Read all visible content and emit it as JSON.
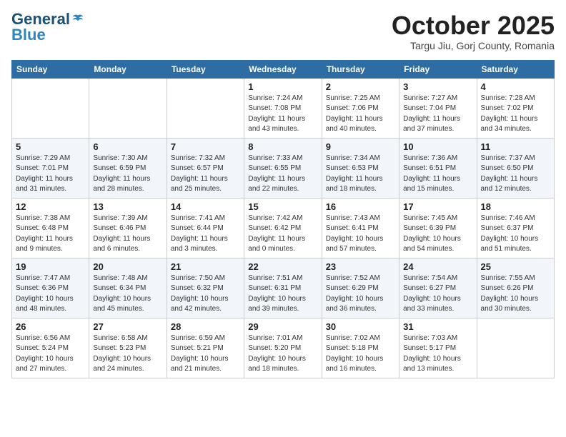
{
  "header": {
    "logo_general": "General",
    "logo_blue": "Blue",
    "month_title": "October 2025",
    "subtitle": "Targu Jiu, Gorj County, Romania"
  },
  "weekdays": [
    "Sunday",
    "Monday",
    "Tuesday",
    "Wednesday",
    "Thursday",
    "Friday",
    "Saturday"
  ],
  "weeks": [
    [
      {
        "day": "",
        "info": ""
      },
      {
        "day": "",
        "info": ""
      },
      {
        "day": "",
        "info": ""
      },
      {
        "day": "1",
        "info": "Sunrise: 7:24 AM\nSunset: 7:08 PM\nDaylight: 11 hours and 43 minutes."
      },
      {
        "day": "2",
        "info": "Sunrise: 7:25 AM\nSunset: 7:06 PM\nDaylight: 11 hours and 40 minutes."
      },
      {
        "day": "3",
        "info": "Sunrise: 7:27 AM\nSunset: 7:04 PM\nDaylight: 11 hours and 37 minutes."
      },
      {
        "day": "4",
        "info": "Sunrise: 7:28 AM\nSunset: 7:02 PM\nDaylight: 11 hours and 34 minutes."
      }
    ],
    [
      {
        "day": "5",
        "info": "Sunrise: 7:29 AM\nSunset: 7:01 PM\nDaylight: 11 hours and 31 minutes."
      },
      {
        "day": "6",
        "info": "Sunrise: 7:30 AM\nSunset: 6:59 PM\nDaylight: 11 hours and 28 minutes."
      },
      {
        "day": "7",
        "info": "Sunrise: 7:32 AM\nSunset: 6:57 PM\nDaylight: 11 hours and 25 minutes."
      },
      {
        "day": "8",
        "info": "Sunrise: 7:33 AM\nSunset: 6:55 PM\nDaylight: 11 hours and 22 minutes."
      },
      {
        "day": "9",
        "info": "Sunrise: 7:34 AM\nSunset: 6:53 PM\nDaylight: 11 hours and 18 minutes."
      },
      {
        "day": "10",
        "info": "Sunrise: 7:36 AM\nSunset: 6:51 PM\nDaylight: 11 hours and 15 minutes."
      },
      {
        "day": "11",
        "info": "Sunrise: 7:37 AM\nSunset: 6:50 PM\nDaylight: 11 hours and 12 minutes."
      }
    ],
    [
      {
        "day": "12",
        "info": "Sunrise: 7:38 AM\nSunset: 6:48 PM\nDaylight: 11 hours and 9 minutes."
      },
      {
        "day": "13",
        "info": "Sunrise: 7:39 AM\nSunset: 6:46 PM\nDaylight: 11 hours and 6 minutes."
      },
      {
        "day": "14",
        "info": "Sunrise: 7:41 AM\nSunset: 6:44 PM\nDaylight: 11 hours and 3 minutes."
      },
      {
        "day": "15",
        "info": "Sunrise: 7:42 AM\nSunset: 6:42 PM\nDaylight: 11 hours and 0 minutes."
      },
      {
        "day": "16",
        "info": "Sunrise: 7:43 AM\nSunset: 6:41 PM\nDaylight: 10 hours and 57 minutes."
      },
      {
        "day": "17",
        "info": "Sunrise: 7:45 AM\nSunset: 6:39 PM\nDaylight: 10 hours and 54 minutes."
      },
      {
        "day": "18",
        "info": "Sunrise: 7:46 AM\nSunset: 6:37 PM\nDaylight: 10 hours and 51 minutes."
      }
    ],
    [
      {
        "day": "19",
        "info": "Sunrise: 7:47 AM\nSunset: 6:36 PM\nDaylight: 10 hours and 48 minutes."
      },
      {
        "day": "20",
        "info": "Sunrise: 7:48 AM\nSunset: 6:34 PM\nDaylight: 10 hours and 45 minutes."
      },
      {
        "day": "21",
        "info": "Sunrise: 7:50 AM\nSunset: 6:32 PM\nDaylight: 10 hours and 42 minutes."
      },
      {
        "day": "22",
        "info": "Sunrise: 7:51 AM\nSunset: 6:31 PM\nDaylight: 10 hours and 39 minutes."
      },
      {
        "day": "23",
        "info": "Sunrise: 7:52 AM\nSunset: 6:29 PM\nDaylight: 10 hours and 36 minutes."
      },
      {
        "day": "24",
        "info": "Sunrise: 7:54 AM\nSunset: 6:27 PM\nDaylight: 10 hours and 33 minutes."
      },
      {
        "day": "25",
        "info": "Sunrise: 7:55 AM\nSunset: 6:26 PM\nDaylight: 10 hours and 30 minutes."
      }
    ],
    [
      {
        "day": "26",
        "info": "Sunrise: 6:56 AM\nSunset: 5:24 PM\nDaylight: 10 hours and 27 minutes."
      },
      {
        "day": "27",
        "info": "Sunrise: 6:58 AM\nSunset: 5:23 PM\nDaylight: 10 hours and 24 minutes."
      },
      {
        "day": "28",
        "info": "Sunrise: 6:59 AM\nSunset: 5:21 PM\nDaylight: 10 hours and 21 minutes."
      },
      {
        "day": "29",
        "info": "Sunrise: 7:01 AM\nSunset: 5:20 PM\nDaylight: 10 hours and 18 minutes."
      },
      {
        "day": "30",
        "info": "Sunrise: 7:02 AM\nSunset: 5:18 PM\nDaylight: 10 hours and 16 minutes."
      },
      {
        "day": "31",
        "info": "Sunrise: 7:03 AM\nSunset: 5:17 PM\nDaylight: 10 hours and 13 minutes."
      },
      {
        "day": "",
        "info": ""
      }
    ]
  ]
}
